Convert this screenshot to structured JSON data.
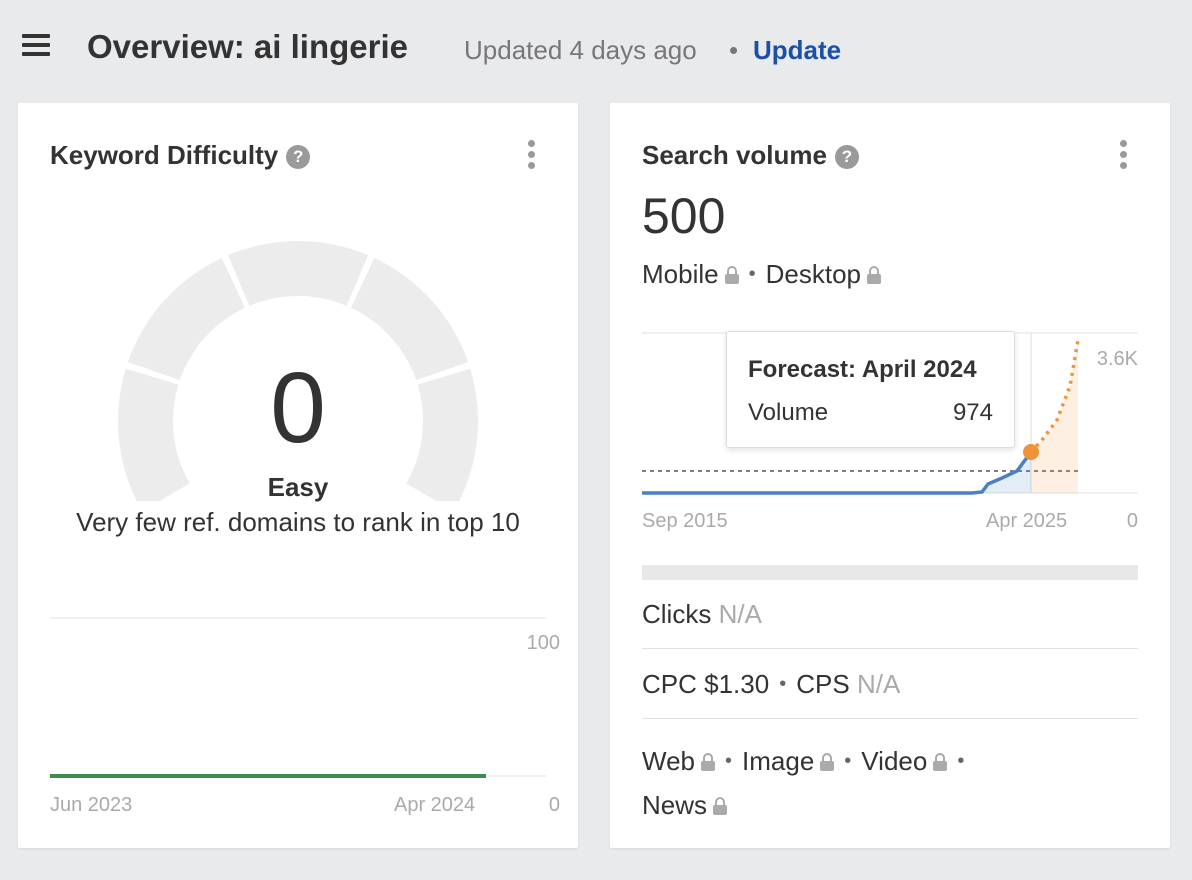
{
  "header": {
    "title": "Overview: ai lingerie",
    "updated_text": "Updated 4 days ago",
    "separator": "•",
    "update_link": "Update"
  },
  "keyword_difficulty": {
    "title": "Keyword Difficulty",
    "help_glyph": "?",
    "value": "0",
    "label": "Easy",
    "description": "Very few ref. domains to rank in top 10",
    "chart": {
      "y_max_label": "100",
      "y_min_label": "0",
      "x_start_label": "Jun 2023",
      "x_end_label": "Apr 2024",
      "line_color": "#3a8c4f"
    },
    "gauge_color": "#ececec"
  },
  "search_volume": {
    "title": "Search volume",
    "help_glyph": "?",
    "value": "500",
    "devices": {
      "mobile": "Mobile",
      "desktop": "Desktop",
      "separator": "•"
    },
    "chart": {
      "y_max_label": "3.6K",
      "y_min_label": "0",
      "x_start_label": "Sep 2015",
      "x_end_label": "Apr 2025",
      "history_color": "#4a7fc1",
      "forecast_color": "#f0923a"
    },
    "tooltip": {
      "title": "Forecast: April 2024",
      "key": "Volume",
      "value": "974"
    },
    "clicks": {
      "label": "Clicks",
      "value": "N/A"
    },
    "cpc": {
      "label": "CPC",
      "value": "$1.30",
      "separator": "•"
    },
    "cps": {
      "label": "CPS",
      "value": "N/A"
    },
    "serp_features": {
      "web": "Web",
      "image": "Image",
      "video": "Video",
      "news": "News",
      "separator": "•"
    }
  },
  "icons": {
    "menu": "menu-icon",
    "help": "help-icon",
    "kebab": "kebab-icon",
    "lock": "lock-icon"
  }
}
